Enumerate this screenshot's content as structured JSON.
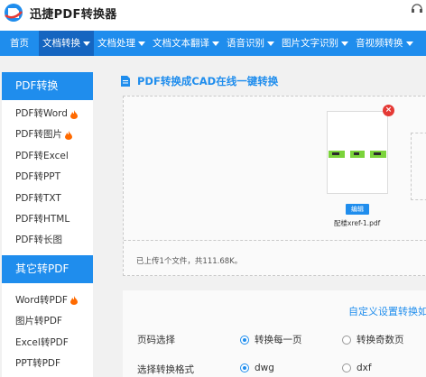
{
  "header": {
    "brand": "迅捷PDF转换器",
    "logo_icon": "brand-logo-icon",
    "corner_icon": "headset-icon"
  },
  "nav": {
    "items": [
      {
        "label": "首页",
        "dropdown": false,
        "active": false
      },
      {
        "label": "文档转换",
        "dropdown": true,
        "active": true
      },
      {
        "label": "文档处理",
        "dropdown": true,
        "active": false
      },
      {
        "label": "文档文本翻译",
        "dropdown": true,
        "active": false
      },
      {
        "label": "语音识别",
        "dropdown": true,
        "active": false
      },
      {
        "label": "图片文字识别",
        "dropdown": true,
        "active": false
      },
      {
        "label": "音视频转换",
        "dropdown": true,
        "active": false
      }
    ]
  },
  "sidebar": {
    "section1": "PDF转换",
    "items1": [
      {
        "label": "PDF转Word",
        "hot": true
      },
      {
        "label": "PDF转图片",
        "hot": true
      },
      {
        "label": "PDF转Excel",
        "hot": false
      },
      {
        "label": "PDF转PPT",
        "hot": false
      },
      {
        "label": "PDF转TXT",
        "hot": false
      },
      {
        "label": "PDF转HTML",
        "hot": false
      },
      {
        "label": "PDF转长图",
        "hot": false
      }
    ],
    "section2": "其它转PDF",
    "items2": [
      {
        "label": "Word转PDF",
        "hot": true
      },
      {
        "label": "图片转PDF",
        "hot": false
      },
      {
        "label": "Excel转PDF",
        "hot": false
      },
      {
        "label": "PPT转PDF",
        "hot": false
      }
    ]
  },
  "main": {
    "title": "PDF转换成CAD在线一键转换",
    "file": {
      "name": "配楼xref-1.pdf",
      "edit_label": "编辑",
      "close_label": "×"
    },
    "upload_info": "已上传1个文件，共111.68K。",
    "custom_link": "自定义设置转换如",
    "page_select": {
      "label": "页码选择",
      "options": [
        {
          "label": "转换每一页",
          "checked": true
        },
        {
          "label": "转换奇数页",
          "checked": false
        }
      ]
    },
    "format_select": {
      "label": "选择转换格式",
      "options": [
        {
          "label": "dwg",
          "checked": true
        },
        {
          "label": "dxf",
          "checked": false
        }
      ]
    }
  },
  "colors": {
    "accent": "#1f8ded",
    "nav_active": "#1565c0",
    "hot": "#ff6a00",
    "close": "#e53935"
  }
}
